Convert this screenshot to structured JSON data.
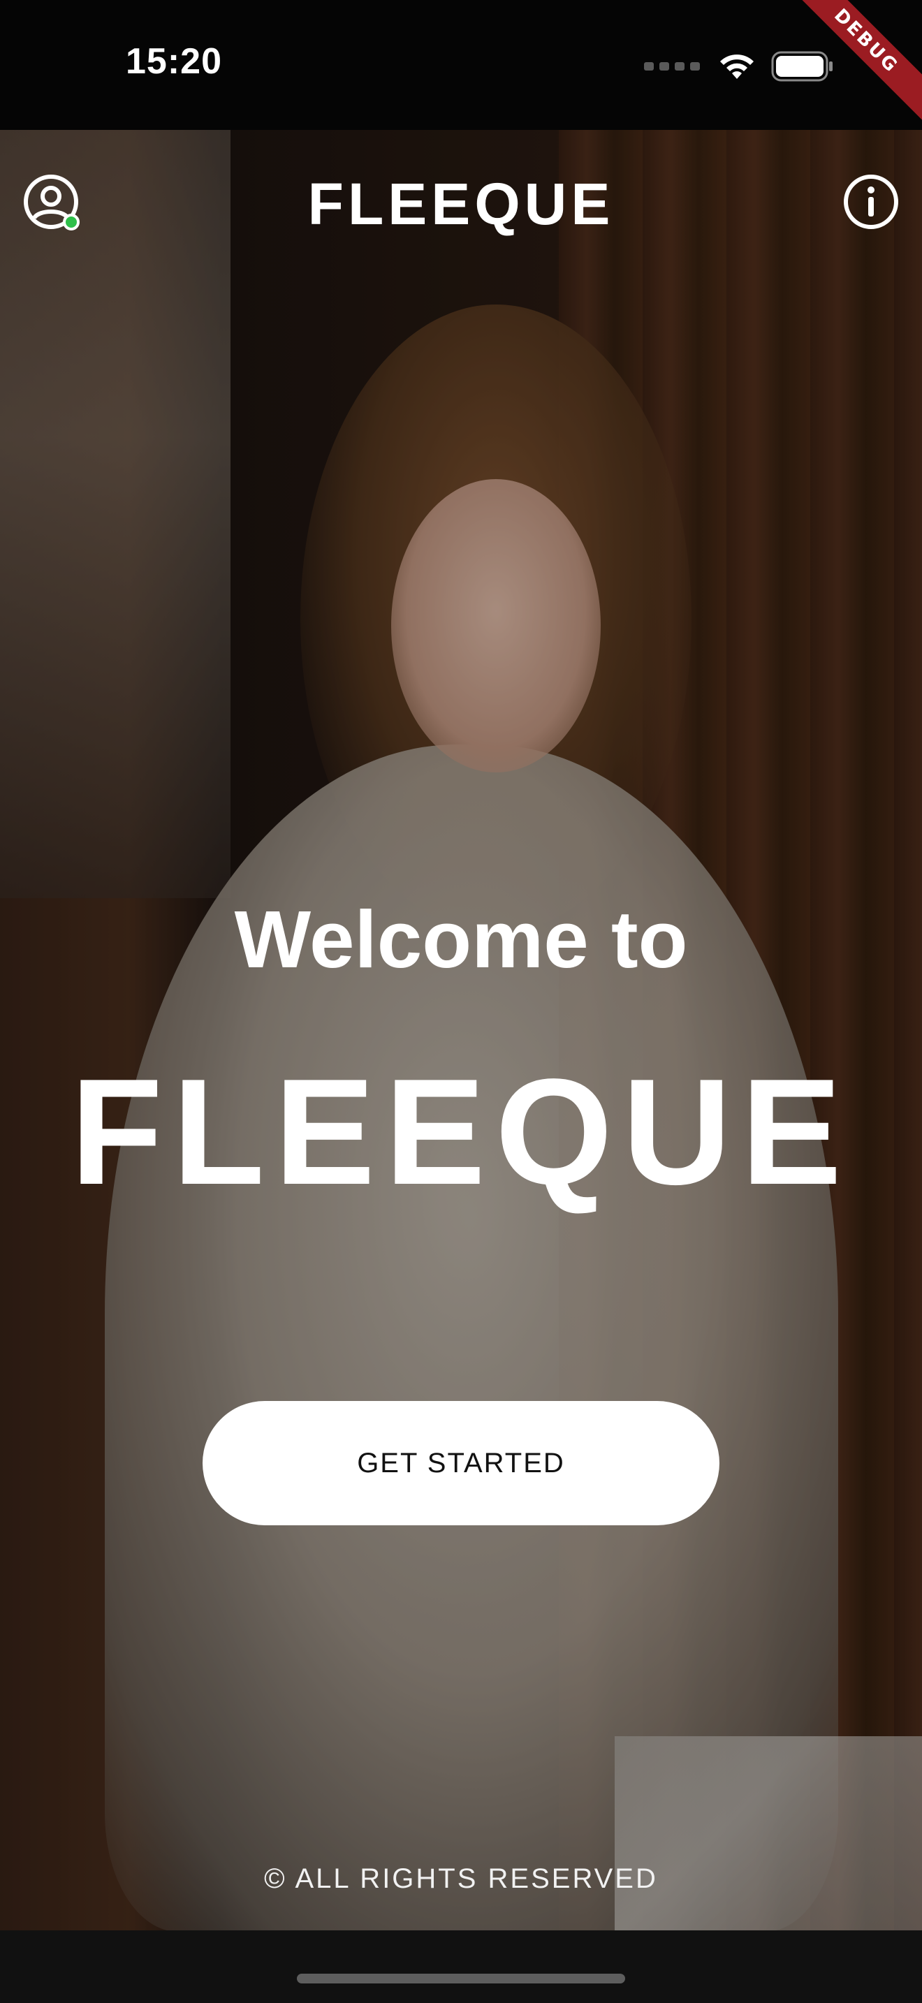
{
  "status_bar": {
    "time": "15:20",
    "debug_label": "DEBUG"
  },
  "header": {
    "title": "FLEEQUE",
    "profile_icon": "account-circle-icon",
    "info_icon": "info-icon"
  },
  "welcome": {
    "line1": "Welcome to",
    "brand": "FLEEQUE"
  },
  "cta": {
    "get_started_label": "GET STARTED"
  },
  "footer": {
    "copyright": "© ALL RIGHTS RESERVED"
  },
  "colors": {
    "online_indicator": "#2fbf4a",
    "button_bg": "#ffffff",
    "debug_ribbon": "#9b1c22"
  }
}
